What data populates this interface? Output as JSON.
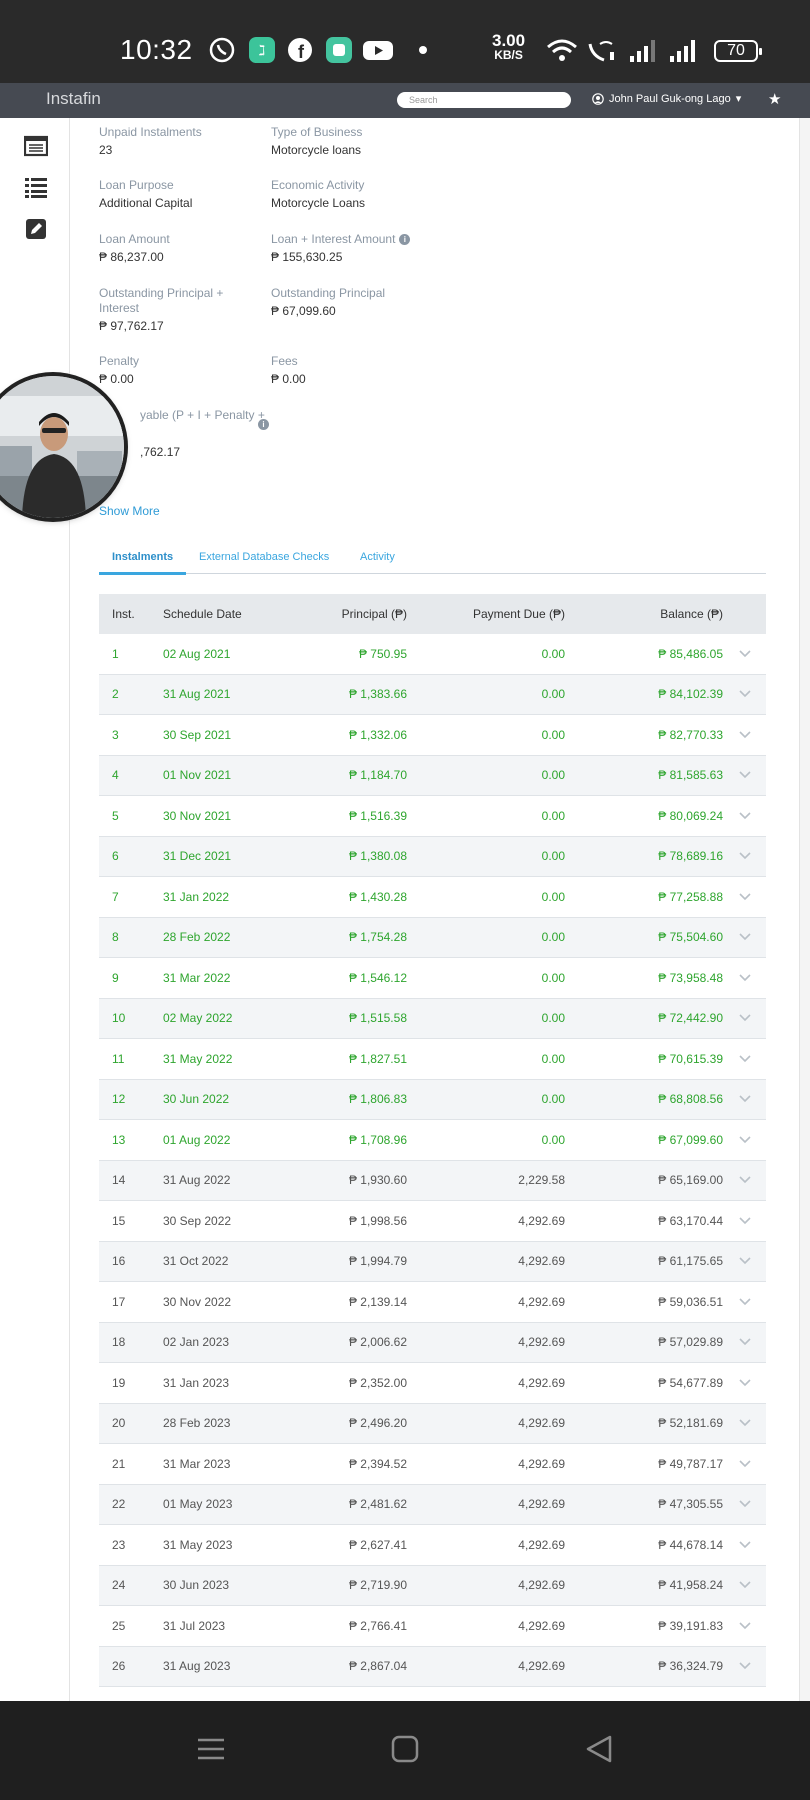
{
  "status_bar": {
    "time": "10:32",
    "net_speed": "3.00",
    "net_unit": "KB/S",
    "battery": "70",
    "icons": [
      "viber-icon",
      "app-icon",
      "facebook-icon",
      "app2-icon",
      "youtube-icon",
      "dot-icon",
      "wifi-icon",
      "wifi-call-icon",
      "signal-icon",
      "signal-icon-2",
      "battery-icon"
    ]
  },
  "app_bar": {
    "brand": "Instafin",
    "search_placeholder": "Search",
    "user_name": "John Paul Guk-ong Lago",
    "user_caret": "▾",
    "star": "★"
  },
  "details": {
    "unpaid_instalments": {
      "label": "Unpaid Instalments",
      "value": "23"
    },
    "type_of_business": {
      "label": "Type of Business",
      "value": "Motorcycle loans"
    },
    "loan_purpose": {
      "label": "Loan Purpose",
      "value": "Additional Capital"
    },
    "economic_activity": {
      "label": "Economic Activity",
      "value": "Motorcycle Loans"
    },
    "loan_amount": {
      "label": "Loan Amount",
      "value": "₱ 86,237.00"
    },
    "loan_interest_amount": {
      "label": "Loan + Interest Amount",
      "value": "₱ 155,630.25"
    },
    "outstanding_principal_interest": {
      "label": "Outstanding Principal + Interest",
      "value": "₱ 97,762.17"
    },
    "outstanding_principal": {
      "label": "Outstanding Principal",
      "value": "₱ 67,099.60"
    },
    "penalty": {
      "label": "Penalty",
      "value": "₱ 0.00"
    },
    "fees": {
      "label": "Fees",
      "value": "₱ 0.00"
    },
    "payable": {
      "label": "yable (P + I + Penalty +",
      "value": ",762.17"
    },
    "show_more": "Show More"
  },
  "tabs": [
    {
      "label": "Instalments",
      "active": true
    },
    {
      "label": "External Database Checks",
      "active": false
    },
    {
      "label": "Activity",
      "active": false
    }
  ],
  "table": {
    "headers": [
      "Inst.",
      "Schedule Date",
      "Principal (₱)",
      "Payment Due (₱)",
      "Balance (₱)"
    ],
    "rows": [
      {
        "inst": "1",
        "date": "02 Aug 2021",
        "principal": "₱ 750.95",
        "due": "0.00",
        "balance": "₱ 85,486.05",
        "status": "paid"
      },
      {
        "inst": "2",
        "date": "31 Aug 2021",
        "principal": "₱ 1,383.66",
        "due": "0.00",
        "balance": "₱ 84,102.39",
        "status": "paid"
      },
      {
        "inst": "3",
        "date": "30 Sep 2021",
        "principal": "₱ 1,332.06",
        "due": "0.00",
        "balance": "₱ 82,770.33",
        "status": "paid"
      },
      {
        "inst": "4",
        "date": "01 Nov 2021",
        "principal": "₱ 1,184.70",
        "due": "0.00",
        "balance": "₱ 81,585.63",
        "status": "paid"
      },
      {
        "inst": "5",
        "date": "30 Nov 2021",
        "principal": "₱ 1,516.39",
        "due": "0.00",
        "balance": "₱ 80,069.24",
        "status": "paid"
      },
      {
        "inst": "6",
        "date": "31 Dec 2021",
        "principal": "₱ 1,380.08",
        "due": "0.00",
        "balance": "₱ 78,689.16",
        "status": "paid"
      },
      {
        "inst": "7",
        "date": "31 Jan 2022",
        "principal": "₱ 1,430.28",
        "due": "0.00",
        "balance": "₱ 77,258.88",
        "status": "paid"
      },
      {
        "inst": "8",
        "date": "28 Feb 2022",
        "principal": "₱ 1,754.28",
        "due": "0.00",
        "balance": "₱ 75,504.60",
        "status": "paid"
      },
      {
        "inst": "9",
        "date": "31 Mar 2022",
        "principal": "₱ 1,546.12",
        "due": "0.00",
        "balance": "₱ 73,958.48",
        "status": "paid"
      },
      {
        "inst": "10",
        "date": "02 May 2022",
        "principal": "₱ 1,515.58",
        "due": "0.00",
        "balance": "₱ 72,442.90",
        "status": "paid"
      },
      {
        "inst": "11",
        "date": "31 May 2022",
        "principal": "₱ 1,827.51",
        "due": "0.00",
        "balance": "₱ 70,615.39",
        "status": "paid"
      },
      {
        "inst": "12",
        "date": "30 Jun 2022",
        "principal": "₱ 1,806.83",
        "due": "0.00",
        "balance": "₱ 68,808.56",
        "status": "paid"
      },
      {
        "inst": "13",
        "date": "01 Aug 2022",
        "principal": "₱ 1,708.96",
        "due": "0.00",
        "balance": "₱ 67,099.60",
        "status": "paid"
      },
      {
        "inst": "14",
        "date": "31 Aug 2022",
        "principal": "₱ 1,930.60",
        "due": "2,229.58",
        "balance": "₱ 65,169.00",
        "status": "due"
      },
      {
        "inst": "15",
        "date": "30 Sep 2022",
        "principal": "₱ 1,998.56",
        "due": "4,292.69",
        "balance": "₱ 63,170.44",
        "status": "due"
      },
      {
        "inst": "16",
        "date": "31 Oct 2022",
        "principal": "₱ 1,994.79",
        "due": "4,292.69",
        "balance": "₱ 61,175.65",
        "status": "due"
      },
      {
        "inst": "17",
        "date": "30 Nov 2022",
        "principal": "₱ 2,139.14",
        "due": "4,292.69",
        "balance": "₱ 59,036.51",
        "status": "due"
      },
      {
        "inst": "18",
        "date": "02 Jan 2023",
        "principal": "₱ 2,006.62",
        "due": "4,292.69",
        "balance": "₱ 57,029.89",
        "status": "due"
      },
      {
        "inst": "19",
        "date": "31 Jan 2023",
        "principal": "₱ 2,352.00",
        "due": "4,292.69",
        "balance": "₱ 54,677.89",
        "status": "due"
      },
      {
        "inst": "20",
        "date": "28 Feb 2023",
        "principal": "₱ 2,496.20",
        "due": "4,292.69",
        "balance": "₱ 52,181.69",
        "status": "due"
      },
      {
        "inst": "21",
        "date": "31 Mar 2023",
        "principal": "₱ 2,394.52",
        "due": "4,292.69",
        "balance": "₱ 49,787.17",
        "status": "due"
      },
      {
        "inst": "22",
        "date": "01 May 2023",
        "principal": "₱ 2,481.62",
        "due": "4,292.69",
        "balance": "₱ 47,305.55",
        "status": "due"
      },
      {
        "inst": "23",
        "date": "31 May 2023",
        "principal": "₱ 2,627.41",
        "due": "4,292.69",
        "balance": "₱ 44,678.14",
        "status": "due"
      },
      {
        "inst": "24",
        "date": "30 Jun 2023",
        "principal": "₱ 2,719.90",
        "due": "4,292.69",
        "balance": "₱ 41,958.24",
        "status": "due"
      },
      {
        "inst": "25",
        "date": "31 Jul 2023",
        "principal": "₱ 2,766.41",
        "due": "4,292.69",
        "balance": "₱ 39,191.83",
        "status": "due"
      },
      {
        "inst": "26",
        "date": "31 Aug 2023",
        "principal": "₱ 2,867.04",
        "due": "4,292.69",
        "balance": "₱ 36,324.79",
        "status": "due"
      }
    ]
  },
  "colors": {
    "paid": "#2ea52e",
    "link": "#2f9bd6",
    "header_bg": "#464a52"
  }
}
